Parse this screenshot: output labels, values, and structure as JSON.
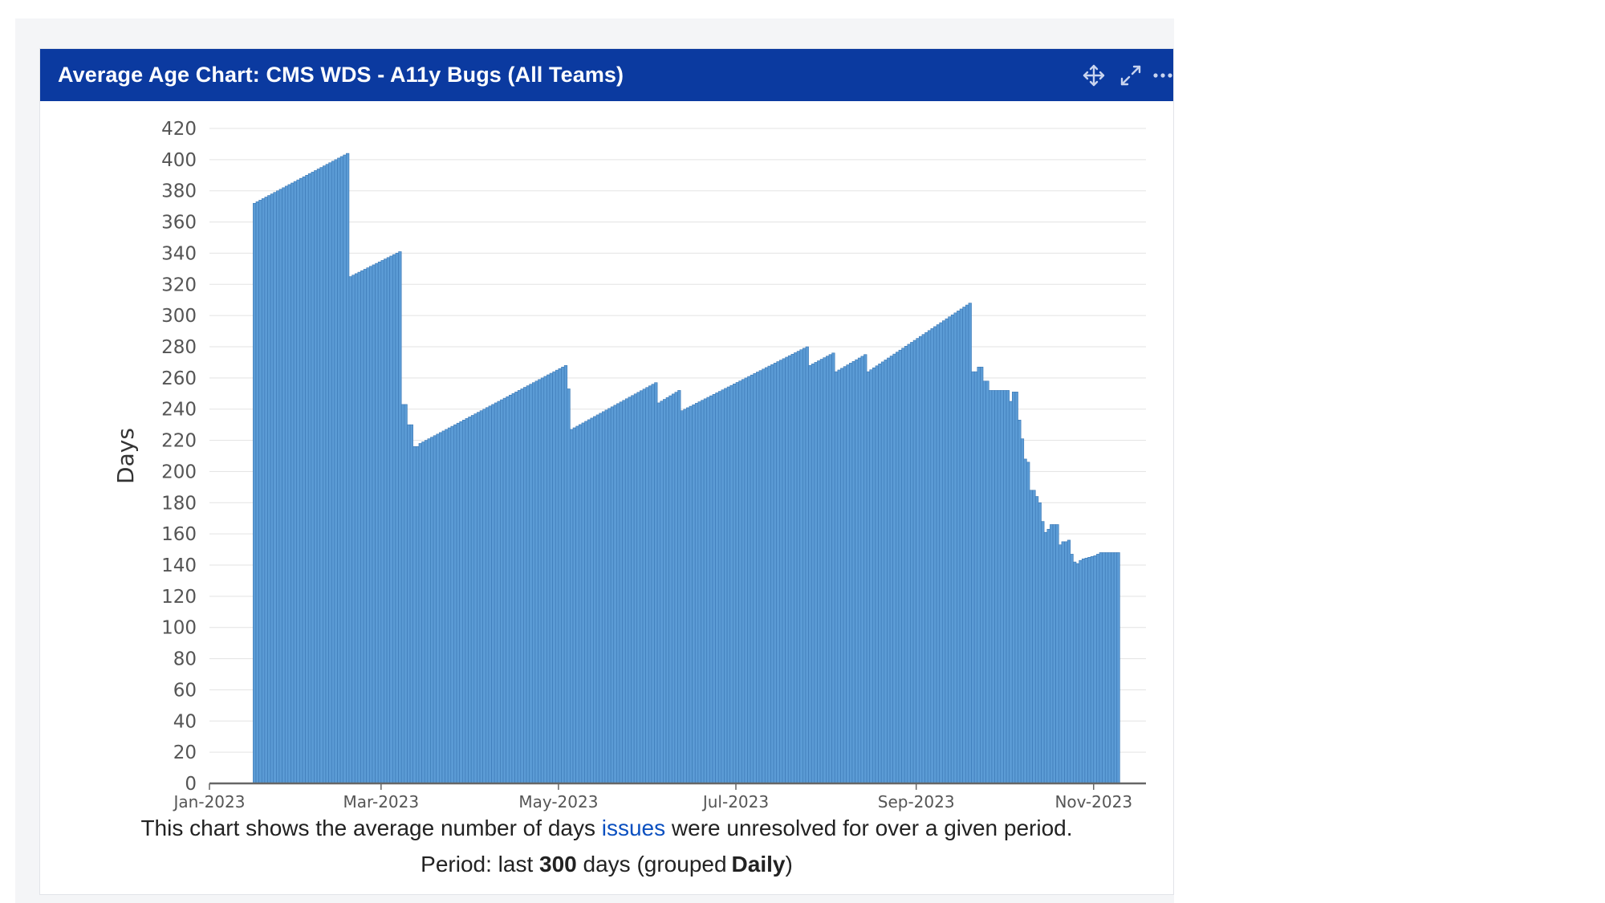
{
  "gadget": {
    "title": "Average Age Chart: CMS WDS - A11y Bugs (All Teams)",
    "icons": [
      "move-icon",
      "expand-icon",
      "more-icon"
    ]
  },
  "caption": {
    "line1_before": "This chart shows the average number of days",
    "line1_link": "issues",
    "line1_after": "were unresolved for over a given period.",
    "line2_before": "Period: last",
    "line2_days": "300",
    "line2_mid": "days (grouped",
    "line2_group": "Daily",
    "line2_after": ")"
  },
  "colors": {
    "header_bg": "#0b3aa0",
    "bar_fill": "#5b9bd5",
    "bar_stroke": "#3b78b5",
    "link": "#0b50c0"
  },
  "chart_data": {
    "type": "bar",
    "ylabel": "Days",
    "xlabel": "",
    "ylim": [
      0,
      420
    ],
    "yticks": [
      0,
      20,
      40,
      60,
      80,
      100,
      120,
      140,
      160,
      180,
      200,
      220,
      240,
      260,
      280,
      300,
      320,
      340,
      360,
      380,
      400,
      420
    ],
    "xticks": [
      "Jan-2023",
      "Mar-2023",
      "May-2023",
      "Jul-2023",
      "Sep-2023",
      "Nov-2023"
    ],
    "grid": true,
    "x": [
      "2023-01-16",
      "2023-02-17",
      "2023-02-18",
      "2023-03-07",
      "2023-03-08",
      "2023-03-10",
      "2023-03-12",
      "2023-03-14",
      "2023-05-03",
      "2023-05-04",
      "2023-05-05",
      "2023-06-03",
      "2023-06-04",
      "2023-06-11",
      "2023-06-12",
      "2023-07-25",
      "2023-07-26",
      "2023-08-03",
      "2023-08-04",
      "2023-08-14",
      "2023-08-15",
      "2023-09-19",
      "2023-09-20",
      "2023-09-22",
      "2023-09-24",
      "2023-09-26",
      "2023-10-03",
      "2023-10-04",
      "2023-10-06",
      "2023-10-07",
      "2023-10-08",
      "2023-10-09",
      "2023-10-10",
      "2023-10-12",
      "2023-10-13",
      "2023-10-14",
      "2023-10-15",
      "2023-10-16",
      "2023-10-17",
      "2023-10-20",
      "2023-10-21",
      "2023-10-23",
      "2023-10-24",
      "2023-10-25",
      "2023-10-26",
      "2023-10-27",
      "2023-10-28",
      "2023-11-01",
      "2023-11-02",
      "2023-11-03",
      "2023-11-09"
    ],
    "values": [
      372,
      404,
      325,
      341,
      243,
      230,
      216,
      218,
      268,
      253,
      227,
      257,
      244,
      252,
      239,
      280,
      268,
      276,
      264,
      275,
      264,
      308,
      264,
      267,
      258,
      252,
      245,
      251,
      233,
      221,
      208,
      206,
      188,
      184,
      180,
      168,
      161,
      163,
      166,
      153,
      155,
      156,
      147,
      142,
      141,
      143,
      144,
      146,
      147,
      148,
      148
    ]
  }
}
